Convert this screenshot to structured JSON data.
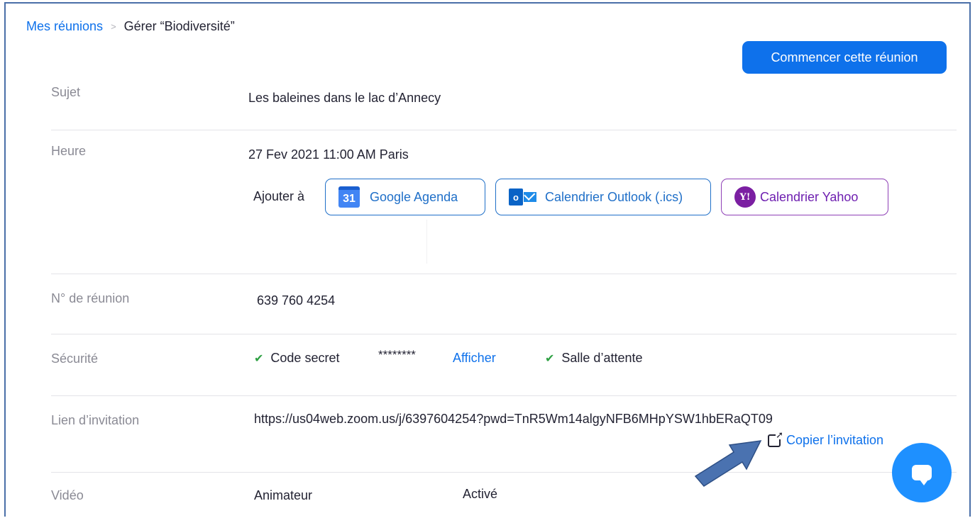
{
  "breadcrumb": {
    "link": "Mes réunions",
    "separator": ">",
    "current": "Gérer “Biodiversité”"
  },
  "start_button": "Commencer cette réunion",
  "subject": {
    "label": "Sujet",
    "value": "Les baleines dans le lac d’Annecy"
  },
  "time": {
    "label": "Heure",
    "value": "27 Fev 2021 11:00 AM Paris",
    "add_to": "Ajouter à",
    "calendars": {
      "google": {
        "icon": "google-calendar-icon",
        "icon_text": "31",
        "label": "Google Agenda"
      },
      "outlook": {
        "icon": "outlook-icon",
        "icon_text": "o",
        "label": "Calendrier Outlook (.ics)"
      },
      "yahoo": {
        "icon": "yahoo-icon",
        "icon_text": "Y!",
        "label": "Calendrier Yahoo"
      }
    }
  },
  "meeting_id": {
    "label": "N° de réunion",
    "value": "639 760 4254"
  },
  "security": {
    "label": "Sécurité",
    "passcode_label": "Code secret",
    "passcode_value": "********",
    "show_link": "Afficher",
    "waiting_room": "Salle d’attente",
    "check_icon": "✔"
  },
  "invite": {
    "label": "Lien d’invitation",
    "url": "https://us04web.zoom.us/j/6397604254?pwd=TnR5Wm14algyNFB6MHpYSW1hbERaQT09",
    "copy_label": "Copier l’invitation"
  },
  "video": {
    "label": "Vidéo",
    "host_label": "Animateur",
    "host_value": "Activé"
  },
  "colors": {
    "accent": "#0e71eb",
    "arrow": "#4a72b0",
    "check": "#2ea043",
    "yahoo": "#7b1fa2"
  }
}
